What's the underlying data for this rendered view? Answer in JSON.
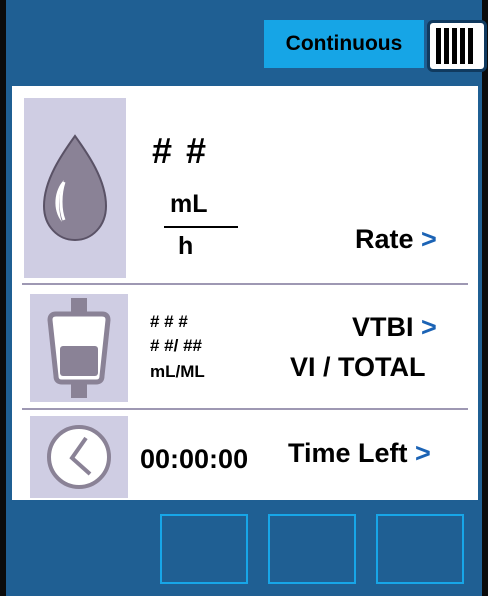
{
  "status": {
    "mode": "Continuous",
    "battery_bars": 5
  },
  "rate": {
    "value": "# #",
    "unit_numerator": "mL",
    "unit_denominator": "h",
    "label": "Rate",
    "arrow": ">"
  },
  "volume": {
    "line1": "# # #",
    "line2": "# #/ ##",
    "line3": "mL/ML",
    "label_vtbi": "VTBI",
    "arrow": ">",
    "label_vi_total": "VI / TOTAL"
  },
  "time": {
    "value": "00:00:00",
    "label": "Time Left",
    "arrow": ">"
  },
  "icons": {
    "rate": "drop-icon",
    "volume": "container-icon",
    "time": "clock-icon"
  },
  "colors": {
    "frame": "#1f5f93",
    "badge": "#16a5e6",
    "icon_bg": "#cfcde3",
    "arrow": "#1b63b5"
  }
}
